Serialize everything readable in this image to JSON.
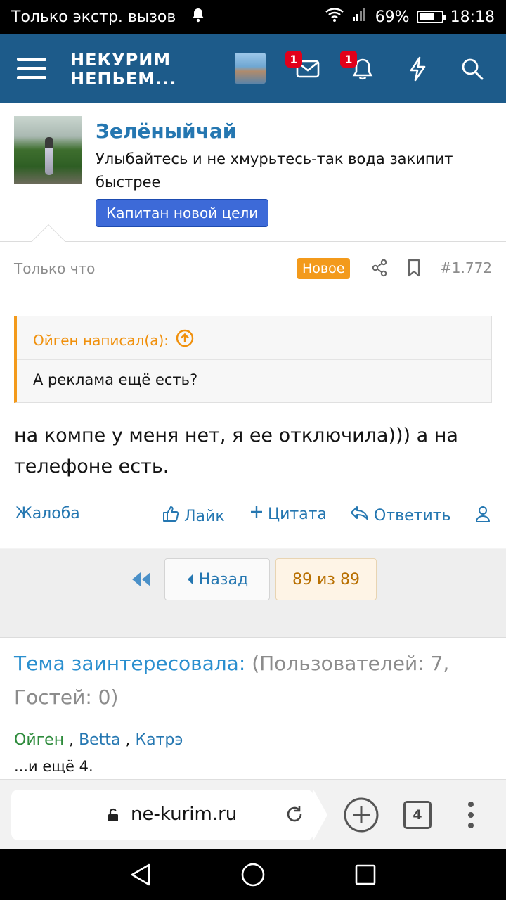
{
  "status_bar": {
    "carrier": "Только экстр. вызов",
    "battery": "69%",
    "battery_level": 0.69,
    "time": "18:18"
  },
  "header": {
    "logo_line1": "НЕКУРИМ",
    "logo_line2": "НЕПЬЕМ...",
    "inbox_badge": "1",
    "alerts_badge": "1"
  },
  "post": {
    "username": "Зелёныйчай",
    "user_title": "Улыбайтесь и не хмурьтесь-так вода закипит быстрее",
    "user_banner": "Капитан новой цели",
    "time": "Только что",
    "new_label": "Новое",
    "post_number": "#1.772",
    "quote": {
      "author": "Ойген написал(а):",
      "text": "А реклама ещё есть?"
    },
    "message": "на компе у меня нет, я ее отключила))) а на телефоне есть.",
    "actions": {
      "report": "Жалоба",
      "like": "Лайк",
      "quote": "Цитата",
      "reply": "Ответить"
    }
  },
  "pager": {
    "prev": "Назад",
    "current": "89 из 89"
  },
  "viewing": {
    "label": "Тема заинтересовала:",
    "counts": "(Пользователей: 7, Гостей: 0)",
    "users": [
      "Ойген",
      "Betta",
      "Катрэ"
    ],
    "separator": ",",
    "more": "...и ещё 4."
  },
  "browser": {
    "url": "ne-kurim.ru",
    "tab_count": "4"
  },
  "colors": {
    "header_bg": "#1d5b8a",
    "link": "#2577b1",
    "accent_orange": "#f39a1b",
    "banner_blue": "#3d6ad8",
    "badge_red": "#e2001a"
  }
}
